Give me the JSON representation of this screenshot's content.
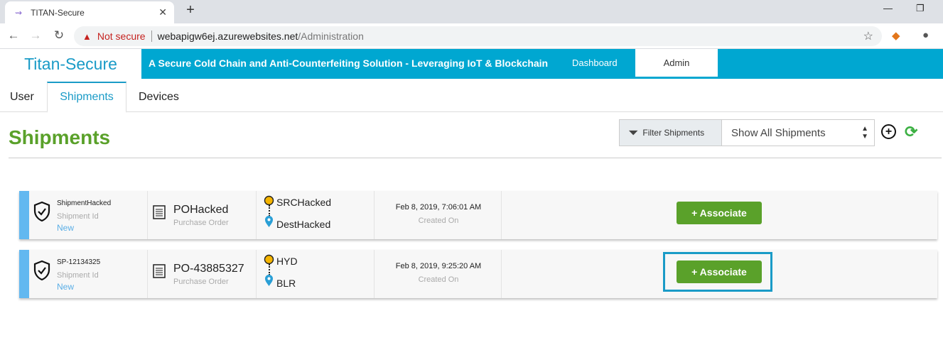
{
  "browser": {
    "tab_title": "TITAN-Secure",
    "tab_close": "✕",
    "new_tab": "+",
    "security_label": "Not secure",
    "url_host": "webapigw6ej.azurewebsites.net",
    "url_path": "/Administration"
  },
  "header": {
    "brand": "Titan-Secure",
    "tagline": "A Secure Cold Chain and Anti-Counterfeiting Solution - Leveraging IoT & Blockchain",
    "nav_dashboard": "Dashboard",
    "nav_admin": "Admin"
  },
  "tabs": [
    {
      "label": "User"
    },
    {
      "label": "Shipments"
    },
    {
      "label": "Devices"
    }
  ],
  "page": {
    "title": "Shipments",
    "filter_label": "Filter Shipments",
    "filter_select": "Show All Shipments"
  },
  "shipments": [
    {
      "id": "ShipmentHacked",
      "id_label": "Shipment Id",
      "status": "New",
      "po": "POHacked",
      "po_label": "Purchase Order",
      "source": "SRCHacked",
      "destination": "DestHacked",
      "created": "Feb 8, 2019, 7:06:01 AM",
      "created_label": "Created On",
      "action": "+ Associate"
    },
    {
      "id": "SP-12134325",
      "id_label": "Shipment Id",
      "status": "New",
      "po": "PO-43885327",
      "po_label": "Purchase Order",
      "source": "HYD",
      "destination": "BLR",
      "created": "Feb 8, 2019, 9:25:20 AM",
      "created_label": "Created On",
      "action": "+ Associate"
    }
  ],
  "colors": {
    "header_bg": "#00a7d1",
    "title_green": "#5aa12a",
    "row_strip": "#62b8f0",
    "button_green": "#5aa12a"
  }
}
